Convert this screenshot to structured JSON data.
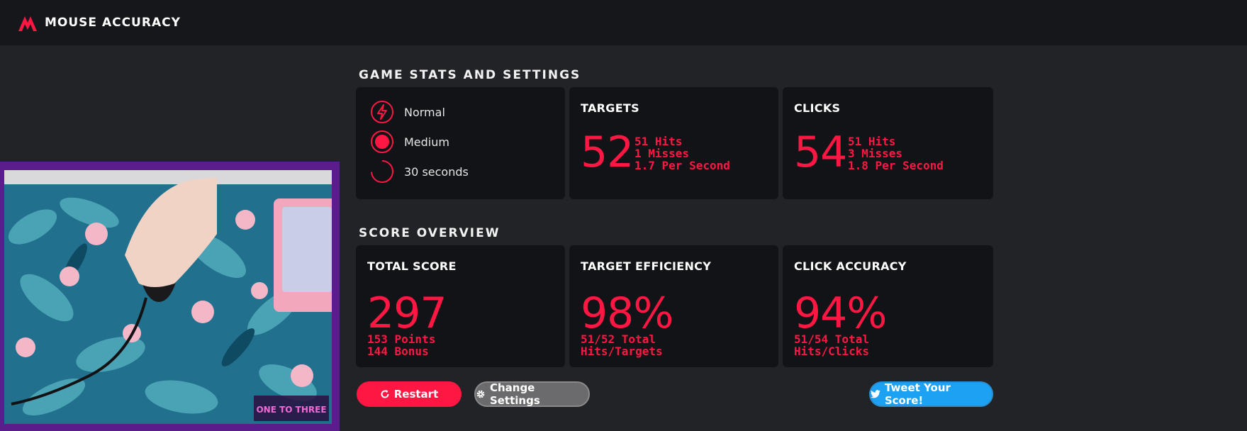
{
  "app": {
    "title": "MOUSE ACCURACY",
    "accent_color": "#ff1744"
  },
  "sections": {
    "stats_title": "GAME STATS AND SETTINGS",
    "score_title": "SCORE OVERVIEW"
  },
  "settings": {
    "mode": {
      "label": "Normal",
      "icon": "lightning-icon"
    },
    "size": {
      "label": "Medium",
      "icon": "target-size-icon"
    },
    "duration": {
      "label": "30 seconds",
      "icon": "timer-icon"
    }
  },
  "targets": {
    "title": "TARGETS",
    "value": "52",
    "hits": "51 Hits",
    "misses": "1 Misses",
    "rate": "1.7 Per Second"
  },
  "clicks": {
    "title": "CLICKS",
    "value": "54",
    "hits": "51 Hits",
    "misses": "3 Misses",
    "rate": "1.8 Per Second"
  },
  "total_score": {
    "title": "TOTAL SCORE",
    "value": "297",
    "line1": "153 Points",
    "line2": "144 Bonus"
  },
  "target_efficiency": {
    "title": "TARGET EFFICIENCY",
    "value": "98%",
    "line1": "51/52 Total",
    "line2": "Hits/Targets"
  },
  "click_accuracy": {
    "title": "CLICK ACCURACY",
    "value": "94%",
    "line1": "51/54 Total",
    "line2": "Hits/Clicks"
  },
  "buttons": {
    "restart": "Restart",
    "change_settings": "Change Settings",
    "tweet": "Tweet Your Score!"
  },
  "webcam": {
    "overlay_logo_text": "ONE TO THREE"
  },
  "colors": {
    "restart_bg": "#ff1744",
    "settings_bg": "#6b6b6d",
    "tweet_bg": "#1da1f2"
  }
}
